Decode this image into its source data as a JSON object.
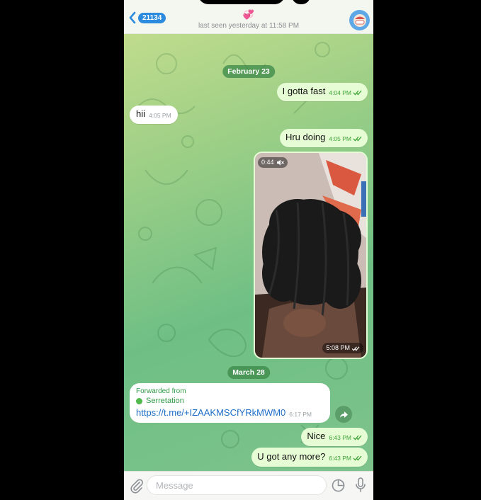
{
  "header": {
    "back_count": "21134",
    "title_emoji": "💞",
    "status": "last seen yesterday at 11:58 PM"
  },
  "messages": {
    "date1": "February 23",
    "m1_text": "I gotta fast",
    "m1_time": "4:04 PM",
    "m2_text": "hii",
    "m2_time": "4:05 PM",
    "m3_text": "Hru doing",
    "m3_time": "4:05 PM",
    "video_duration": "0:44",
    "video_time": "5:08 PM",
    "date2": "March 28",
    "fwd_label": "Forwarded from",
    "fwd_source": "Serretation",
    "fwd_link": "https://t.me/+IZAAKMSCfYRkMWM0",
    "fwd_time": "6:17 PM",
    "m5_text": "Nice",
    "m5_time": "6:43 PM",
    "m6_text": "U got any more?",
    "m6_time": "6:43 PM"
  },
  "input": {
    "placeholder": "Message"
  },
  "icons": [
    "chevron-left-icon",
    "avatar",
    "muted-speaker-icon",
    "double-check-icon",
    "share-icon",
    "paperclip-icon",
    "sticker-icon",
    "microphone-icon"
  ],
  "colors": {
    "outgoing_bubble": "#e6fcd4",
    "incoming_bubble": "#ffffff",
    "accent_blue": "#2c8bde",
    "time_green": "#3fa33a",
    "date_pill": "#3e8a49"
  }
}
